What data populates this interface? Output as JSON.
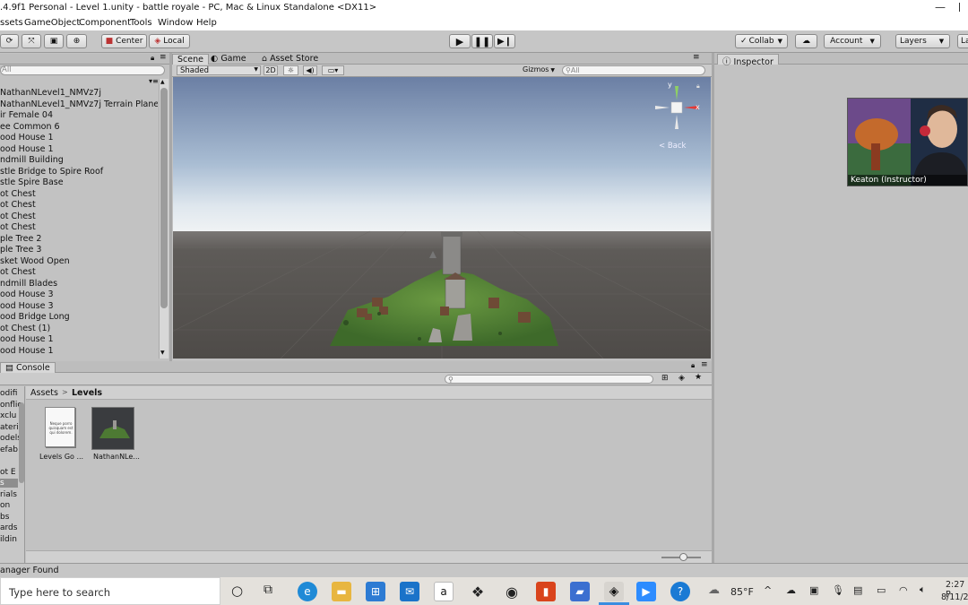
{
  "window": {
    "title": ".4.9f1 Personal - Level 1.unity - battle royale - PC, Mac & Linux Standalone <DX11>",
    "minimize_glyph": "—"
  },
  "menu": [
    "ssets",
    "GameObject",
    "Component",
    "Tools",
    "Window",
    "Help"
  ],
  "toolbar": {
    "center_label": "Center",
    "local_label": "Local",
    "collab_label": "Collab",
    "account_label": "Account",
    "layers_label": "Layers",
    "layout_label": "La"
  },
  "hierarchy": {
    "search_placeholder": "All",
    "items": [
      "NathanNLevel1_NMVz7j",
      "NathanNLevel1_NMVz7j Terrain Plane",
      "ir Female 04",
      "ee Common 6",
      "ood House 1",
      "ood House 1",
      "ndmill Building",
      "stle Bridge to Spire Roof",
      "stle Spire Base",
      "ot Chest",
      "ot Chest",
      "ot Chest",
      "ot Chest",
      "ple Tree 2",
      "ple Tree 3",
      "sket Wood Open",
      "ot Chest",
      "ndmill Blades",
      "ood House 3",
      "ood House 3",
      "ood Bridge Long",
      "ot Chest (1)",
      "ood House 1",
      "ood House 1"
    ]
  },
  "scene": {
    "tabs": [
      "Scene",
      "Game",
      "Asset Store"
    ],
    "shading_mode": "Shaded",
    "mode_2d": "2D",
    "gizmos_label": "Gizmos",
    "search_placeholder": "All",
    "gizmo_back_label": "< Back",
    "gizmo_axis_y": "y",
    "gizmo_axis_x": "x"
  },
  "inspector": {
    "tab_label": "Inspector"
  },
  "webcam": {
    "caption": "Keaton (Instructor)"
  },
  "console": {
    "tab_label": "Console"
  },
  "project": {
    "breadcrumb_root": "Assets",
    "breadcrumb_separator": ">",
    "breadcrumb_current": "Levels",
    "left_items": [
      "odifi",
      "onflic",
      "xclu",
      "ateri",
      "odels",
      "efab",
      "",
      "ot E",
      "s",
      "rials",
      "on",
      "bs",
      "ards",
      "ildin"
    ],
    "assets": [
      {
        "name": "Levels Go ...",
        "preview_text": "Neque porro quisquam est qui dolorem."
      },
      {
        "name": "NathanNLe..."
      }
    ]
  },
  "status": {
    "text": "anager Found"
  },
  "taskbar": {
    "search_placeholder": "Type here to search",
    "weather": "85°F",
    "time": "2:27 P",
    "date": "8/11/2"
  },
  "colors": {
    "unity_panel": "#c2c2c2",
    "sky_top": "#6b7fa4",
    "ground": "#55524f",
    "terrain_green": "#4d7a33",
    "taskbar": "#e4e1dc"
  }
}
